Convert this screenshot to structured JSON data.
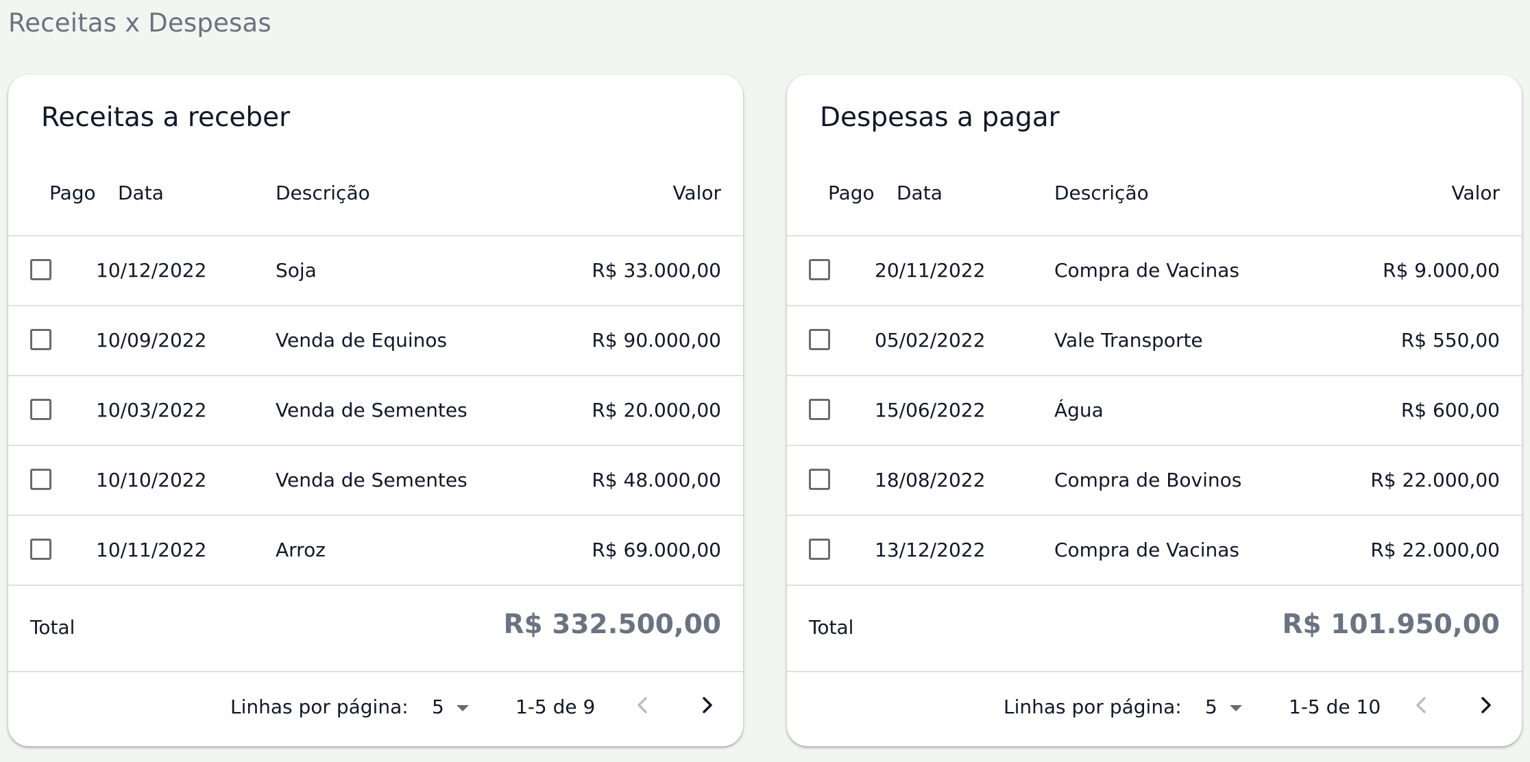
{
  "page": {
    "title": "Receitas x Despesas"
  },
  "columns": {
    "pago": "Pago",
    "data": "Data",
    "descricao": "Descrição",
    "valor": "Valor"
  },
  "receitas": {
    "title": "Receitas a receber",
    "rows": [
      {
        "paid": false,
        "date": "10/12/2022",
        "description": "Soja",
        "value": "R$ 33.000,00"
      },
      {
        "paid": false,
        "date": "10/09/2022",
        "description": "Venda de Equinos",
        "value": "R$ 90.000,00"
      },
      {
        "paid": false,
        "date": "10/03/2022",
        "description": "Venda de Sementes",
        "value": "R$ 20.000,00"
      },
      {
        "paid": false,
        "date": "10/10/2022",
        "description": "Venda de Sementes",
        "value": "R$ 48.000,00"
      },
      {
        "paid": false,
        "date": "10/11/2022",
        "description": "Arroz",
        "value": "R$ 69.000,00"
      }
    ],
    "total_label": "Total",
    "total_value": "R$ 332.500,00",
    "pagination": {
      "rows_per_page_label": "Linhas por página:",
      "rows_per_page": "5",
      "range": "1-5 de 9"
    }
  },
  "despesas": {
    "title": "Despesas a pagar",
    "rows": [
      {
        "paid": false,
        "date": "20/11/2022",
        "description": "Compra de Vacinas",
        "value": "R$ 9.000,00"
      },
      {
        "paid": false,
        "date": "05/02/2022",
        "description": "Vale Transporte",
        "value": "R$ 550,00"
      },
      {
        "paid": false,
        "date": "15/06/2022",
        "description": "Água",
        "value": "R$ 600,00"
      },
      {
        "paid": false,
        "date": "18/08/2022",
        "description": "Compra de Bovinos",
        "value": "R$ 22.000,00"
      },
      {
        "paid": false,
        "date": "13/12/2022",
        "description": "Compra de Vacinas",
        "value": "R$ 22.000,00"
      }
    ],
    "total_label": "Total",
    "total_value": "R$ 101.950,00",
    "pagination": {
      "rows_per_page_label": "Linhas por página:",
      "rows_per_page": "5",
      "range": "1-5 de 10"
    }
  },
  "icons": {
    "prev": "chevron-left-icon",
    "next": "chevron-right-icon",
    "select": "caret-down-icon"
  },
  "colors": {
    "background": "#f2f6f1",
    "card": "#ffffff",
    "muted_text": "#6b7280",
    "divider": "#e1e1e1"
  }
}
